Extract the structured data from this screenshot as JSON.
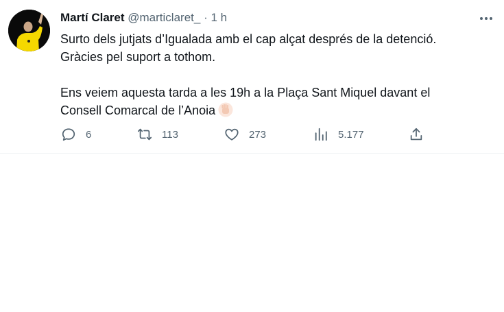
{
  "tweet": {
    "author": {
      "display_name": "Martí Claret",
      "handle": "@marticlaret_",
      "separator": "·",
      "time": "1 h"
    },
    "text": {
      "line1": "Surto dels jutjats d’Igualada amb el cap alçat després de la detenció.",
      "line2": "Gràcies pel suport a tothom.",
      "line3": "Ens veiem aquesta tarda a les 19h a la Plaça Sant Miquel davant el",
      "line4": "Consell Comarcal de l’Anoia",
      "emoji": "raised-fist"
    },
    "actions": {
      "replies": "6",
      "retweets": "113",
      "likes": "273",
      "views": "5.177"
    },
    "icons": {
      "more": "more-horizontal-icon",
      "reply": "reply-icon",
      "retweet": "retweet-icon",
      "like": "heart-icon",
      "views": "views-chart-icon",
      "share": "share-icon"
    },
    "colors": {
      "text": "#0f1419",
      "secondary": "#536471",
      "divider": "#eff3f4",
      "avatar_shirt": "#f5d800"
    }
  }
}
